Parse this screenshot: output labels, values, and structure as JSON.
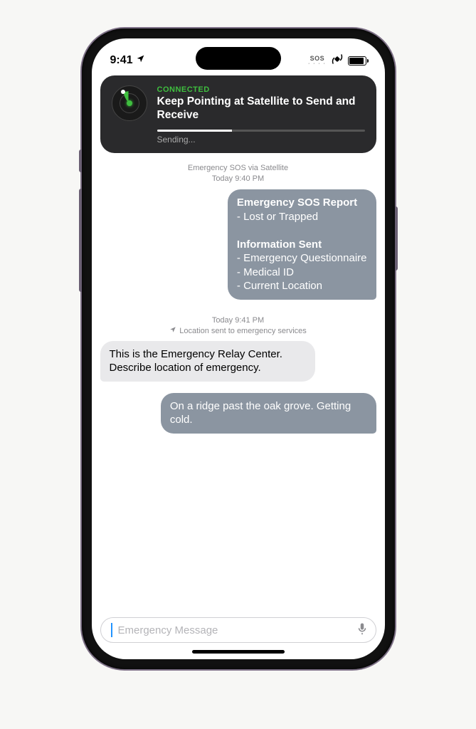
{
  "status_bar": {
    "time": "9:41",
    "sos_label": "SOS"
  },
  "banner": {
    "status": "CONNECTED",
    "title": "Keep Pointing at Satellite to Send and Receive",
    "progress_label": "Sending..."
  },
  "thread_header": {
    "title": "Emergency SOS via Satellite",
    "timestamp": "Today 9:40 PM"
  },
  "messages": {
    "report": {
      "heading1": "Emergency SOS Report",
      "item1": "- Lost or Trapped",
      "heading2": "Information Sent",
      "item2": "- Emergency Questionnaire",
      "item3": "- Medical ID",
      "item4": "- Current Location"
    },
    "midstamp": {
      "time": "Today 9:41 PM",
      "location_note": "Location sent to emergency services"
    },
    "relay_in": "This is the Emergency Relay Center. Describe location of emergency.",
    "reply_out": "On a ridge past the oak grove. Getting cold."
  },
  "input": {
    "placeholder": "Emergency Message"
  }
}
